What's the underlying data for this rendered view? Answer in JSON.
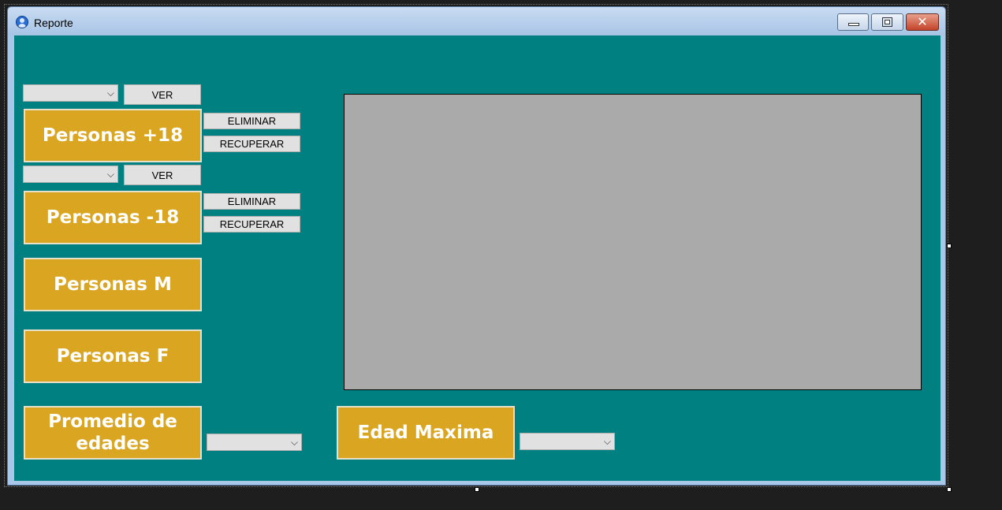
{
  "window": {
    "title": "Reporte"
  },
  "controls": {
    "ver_label": "VER",
    "eliminar_label": "ELIMINAR",
    "recuperar_label": "RECUPERAR",
    "personas_mayor": "Personas +18",
    "personas_menor": "Personas -18",
    "personas_m": "Personas M",
    "personas_f": "Personas F",
    "promedio_edades": "Promedio de edades",
    "edad_maxima": "Edad Maxima"
  },
  "icons": {
    "dropdown_arrow": "chevron-down-icon"
  },
  "colors": {
    "client_background": "#008080",
    "accent_button": "#daa520",
    "chart_placeholder": "#aaaaaa"
  }
}
